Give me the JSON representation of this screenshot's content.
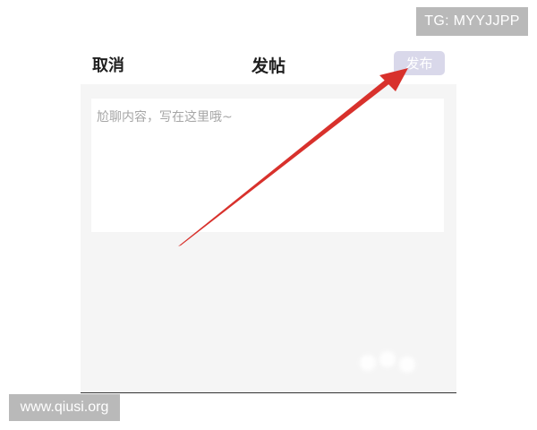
{
  "watermarks": {
    "top_right": "TG: MYYJJPP",
    "bottom_left": "www.qiusi.org"
  },
  "header": {
    "cancel_label": "取消",
    "title": "发帖",
    "publish_label": "发布"
  },
  "editor": {
    "value": "",
    "placeholder": "尬聊内容，写在这里哦~"
  },
  "colors": {
    "arrow": "#d8312c",
    "publish_button_bg": "#d9d8ea",
    "content_bg": "#f5f5f5"
  }
}
